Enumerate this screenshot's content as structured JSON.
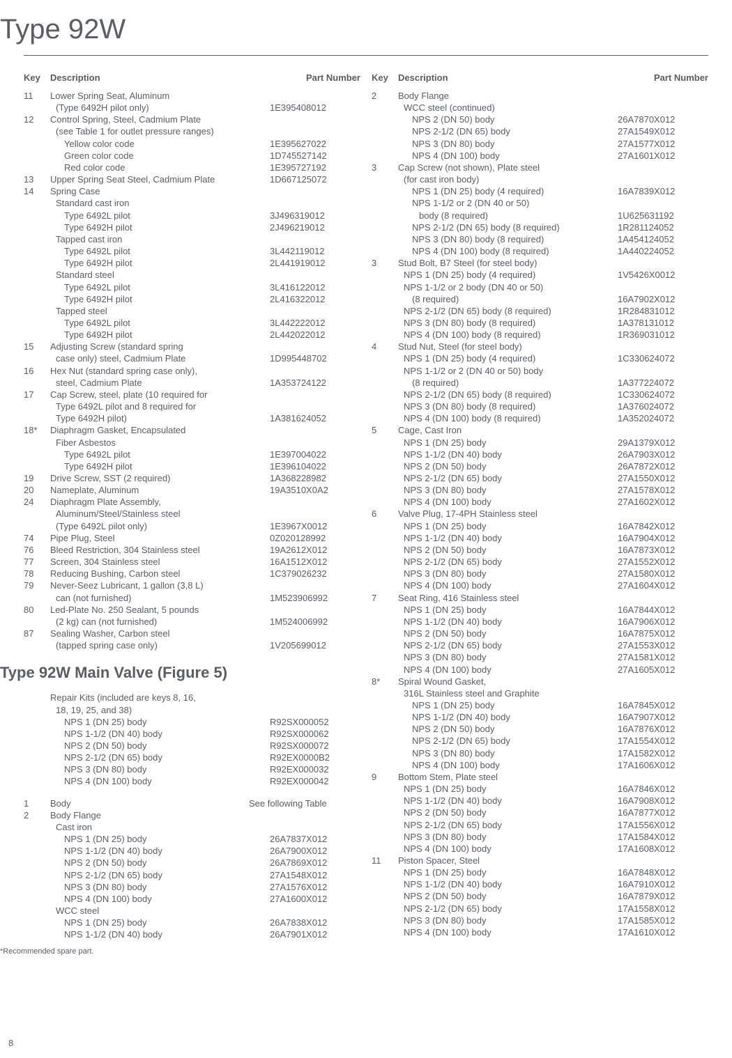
{
  "page_number": "8",
  "title": "Type 92W",
  "section_title": "Type 92W Main Valve (Figure 5)",
  "footnote": "*Recommended spare part.",
  "headers": {
    "key": "Key",
    "description": "Description",
    "part": "Part Number"
  },
  "left": [
    {
      "k": "11",
      "d": "Lower Spring Seat, Aluminum"
    },
    {
      "d": "(Type 6492H pilot only)",
      "i": 1,
      "p": "1E395408012"
    },
    {
      "k": "12",
      "d": "Control Spring, Steel, Cadmium Plate"
    },
    {
      "d": "(see Table 1 for outlet pressure ranges)",
      "i": 1
    },
    {
      "d": "Yellow color code",
      "i": 2,
      "p": "1E395627022"
    },
    {
      "d": "Green color code",
      "i": 2,
      "p": "1D745527142"
    },
    {
      "d": "Red color code",
      "i": 2,
      "p": "1E395727192"
    },
    {
      "k": "13",
      "d": "Upper Spring Seat Steel, Cadmium Plate",
      "p": "1D667125072"
    },
    {
      "k": "14",
      "d": "Spring Case"
    },
    {
      "d": "Standard cast iron",
      "i": 1
    },
    {
      "d": "Type 6492L pilot",
      "i": 2,
      "p": "3J496319012"
    },
    {
      "d": "Type 6492H pilot",
      "i": 2,
      "p": "2J496219012"
    },
    {
      "d": "Tapped cast iron",
      "i": 1
    },
    {
      "d": "Type 6492L pilot",
      "i": 2,
      "p": "3L442119012"
    },
    {
      "d": "Type 6492H pilot",
      "i": 2,
      "p": "2L441919012"
    },
    {
      "d": "Standard steel",
      "i": 1
    },
    {
      "d": "Type 6492L pilot",
      "i": 2,
      "p": "3L416122012"
    },
    {
      "d": "Type 6492H pilot",
      "i": 2,
      "p": "2L416322012"
    },
    {
      "d": "Tapped steel",
      "i": 1
    },
    {
      "d": "Type 6492L pilot",
      "i": 2,
      "p": "3L442222012"
    },
    {
      "d": "Type 6492H pilot",
      "i": 2,
      "p": "2L442022012"
    },
    {
      "k": "15",
      "d": "Adjusting Screw (standard spring"
    },
    {
      "d": "case only) steel, Cadmium Plate",
      "i": 1,
      "p": "1D995448702"
    },
    {
      "k": "16",
      "d": "Hex Nut (standard spring case only),"
    },
    {
      "d": "steel, Cadmium Plate",
      "i": 1,
      "p": "1A353724122"
    },
    {
      "k": "17",
      "d": "Cap Screw, steel, plate (10 required for"
    },
    {
      "d": "Type 6492L pilot and 8 required for",
      "i": 1
    },
    {
      "d": "Type 6492H pilot)",
      "i": 1,
      "p": "1A381624052"
    },
    {
      "k": "18*",
      "d": "Diaphragm Gasket, Encapsulated"
    },
    {
      "d": "Fiber Asbestos",
      "i": 1
    },
    {
      "d": "Type 6492L pilot",
      "i": 2,
      "p": "1E397004022"
    },
    {
      "d": "Type 6492H pilot",
      "i": 2,
      "p": "1E396104022"
    },
    {
      "k": "19",
      "d": "Drive Screw, SST (2 required)",
      "p": "1A368228982"
    },
    {
      "k": "20",
      "d": "Nameplate, Aluminum",
      "p": "19A3510X0A2"
    },
    {
      "k": "24",
      "d": "Diaphragm Plate Assembly,"
    },
    {
      "d": "Aluminum/Steel/Stainless steel",
      "i": 1
    },
    {
      "d": "(Type 6492L pilot only)",
      "i": 1,
      "p": "1E3967X0012"
    },
    {
      "k": "74",
      "d": "Pipe Plug, Steel",
      "p": "0Z020128992"
    },
    {
      "k": "76",
      "d": "Bleed Restriction, 304 Stainless steel",
      "p": "19A2612X012"
    },
    {
      "k": "77",
      "d": "Screen, 304 Stainless steel",
      "p": "16A1512X012"
    },
    {
      "k": "78",
      "d": "Reducing Bushing, Carbon steel",
      "p": "1C379026232"
    },
    {
      "k": "79",
      "d": "Never-Seez Lubricant, 1 gallon (3,8 L)"
    },
    {
      "d": "can (not furnished)",
      "i": 1,
      "p": "1M523906992"
    },
    {
      "k": "80",
      "d": "Led-Plate No. 250 Sealant, 5 pounds"
    },
    {
      "d": "(2 kg) can (not furnished)",
      "i": 1,
      "p": "1M524006992"
    },
    {
      "k": "87",
      "d": "Sealing Washer, Carbon steel"
    },
    {
      "d": "(tapped spring case only)",
      "i": 1,
      "p": "1V205699012"
    }
  ],
  "left2": [
    {
      "d": "Repair Kits  (included  are  keys  8, 16,"
    },
    {
      "d": "18, 19,  25, and 38)",
      "i": 1
    },
    {
      "d": "NPS 1 (DN 25)  body",
      "i": 2,
      "p": "R92SX000052"
    },
    {
      "d": "NPS 1-1/2 (DN 40)  body",
      "i": 2,
      "p": "R92SX000062"
    },
    {
      "d": "NPS 2 (DN 50)  body",
      "i": 2,
      "p": "R92SX000072"
    },
    {
      "d": "NPS 2-1/2 (DN 65)  body",
      "i": 2,
      "p": "R92EX0000B2"
    },
    {
      "d": "NPS 3 (DN 80)  body",
      "i": 2,
      "p": "R92EX000032"
    },
    {
      "d": "NPS 4 (DN 100)  body",
      "i": 2,
      "p": "R92EX000042"
    },
    {
      "sp": true
    },
    {
      "k": "1",
      "d": "Body",
      "p": "See following Table",
      "wide": true
    },
    {
      "k": "2",
      "d": "Body Flange"
    },
    {
      "d": "Cast iron",
      "i": 1
    },
    {
      "d": "NPS 1 (DN 25) body",
      "i": 2,
      "p": "26A7837X012"
    },
    {
      "d": "NPS 1-1/2 (DN 40) body",
      "i": 2,
      "p": "26A7900X012"
    },
    {
      "d": "NPS 2 (DN 50) body",
      "i": 2,
      "p": "26A7869X012"
    },
    {
      "d": "NPS 2-1/2 (DN 65) body",
      "i": 2,
      "p": "27A1548X012"
    },
    {
      "d": "NPS 3 (DN 80) body",
      "i": 2,
      "p": "27A1576X012"
    },
    {
      "d": "NPS 4 (DN 100) body",
      "i": 2,
      "p": "27A1600X012"
    },
    {
      "d": "WCC steel",
      "i": 1
    },
    {
      "d": "NPS 1 (DN 25) body",
      "i": 2,
      "p": "26A7838X012"
    },
    {
      "d": "NPS 1-1/2 (DN 40) body",
      "i": 2,
      "p": "26A7901X012"
    }
  ],
  "right": [
    {
      "k": "2",
      "d": "Body Flange"
    },
    {
      "d": "WCC steel (continued)",
      "i": 1
    },
    {
      "d": "NPS 2 (DN 50) body",
      "i": 2,
      "p": "26A7870X012"
    },
    {
      "d": "NPS 2-1/2 (DN 65) body",
      "i": 2,
      "p": "27A1549X012"
    },
    {
      "d": "NPS 3 (DN 80) body",
      "i": 2,
      "p": "27A1577X012"
    },
    {
      "d": "NPS 4 (DN 100) body",
      "i": 2,
      "p": "27A1601X012"
    },
    {
      "k": "3",
      "d": "Cap Screw (not shown), Plate steel"
    },
    {
      "d": "(for cast iron body)",
      "i": 1
    },
    {
      "d": "NPS 1 (DN 25) body (4 required)",
      "i": 2,
      "p": "16A7839X012"
    },
    {
      "d": "NPS 1-1/2 or 2 (DN 40 or 50)",
      "i": 2
    },
    {
      "d": "body (8 required)",
      "i": 3,
      "p": "1U625631192"
    },
    {
      "d": "NPS 2-1/2 (DN 65) body (8 required)",
      "i": 2,
      "p": "1R281124052"
    },
    {
      "d": "NPS 3 (DN 80) body (8 required)",
      "i": 2,
      "p": "1A454124052"
    },
    {
      "d": "NPS 4 (DN 100) body (8 required)",
      "i": 2,
      "p": "1A440224052"
    },
    {
      "k": "3",
      "d": "Stud Bolt, B7 Steel (for steel body)"
    },
    {
      "d": "NPS 1 (DN 25) body (4 required)",
      "i": 1,
      "p": "1V5426X0012"
    },
    {
      "d": "NPS 1-1/2 or 2 body (DN 40 or 50)",
      "i": 1
    },
    {
      "d": "(8 required)",
      "i": 2,
      "p": "16A7902X012"
    },
    {
      "d": "NPS 2-1/2 (DN 65) body (8 required)",
      "i": 1,
      "p": "1R284831012"
    },
    {
      "d": "NPS 3 (DN 80) body (8 required)",
      "i": 1,
      "p": "1A378131012"
    },
    {
      "d": "NPS 4 (DN 100) body (8 required)",
      "i": 1,
      "p": "1R369031012"
    },
    {
      "k": "4",
      "d": "Stud Nut, Steel (for steel body)"
    },
    {
      "d": "NPS 1 (DN 25) body (4 required)",
      "i": 1,
      "p": "1C330624072"
    },
    {
      "d": "NPS 1-1/2 or 2 (DN 40 or 50) body",
      "i": 1
    },
    {
      "d": "(8 required)",
      "i": 2,
      "p": "1A377224072"
    },
    {
      "d": "NPS 2-1/2 (DN 65) body (8 required)",
      "i": 1,
      "p": "1C330624072"
    },
    {
      "d": "NPS 3 (DN 80) body (8 required)",
      "i": 1,
      "p": "1A376024072"
    },
    {
      "d": "NPS 4 (DN 100) body (8 required)",
      "i": 1,
      "p": "1A352024072"
    },
    {
      "k": "5",
      "d": "Cage, Cast Iron"
    },
    {
      "d": "NPS 1 (DN 25) body",
      "i": 1,
      "p": "29A1379X012"
    },
    {
      "d": "NPS 1-1/2 (DN 40) body",
      "i": 1,
      "p": "26A7903X012"
    },
    {
      "d": "NPS 2 (DN 50) body",
      "i": 1,
      "p": "26A7872X012"
    },
    {
      "d": "NPS 2-1/2 (DN 65) body",
      "i": 1,
      "p": "27A1550X012"
    },
    {
      "d": "NPS 3 (DN 80) body",
      "i": 1,
      "p": "27A1578X012"
    },
    {
      "d": "NPS 4 (DN 100) body",
      "i": 1,
      "p": "27A1602X012"
    },
    {
      "k": "6",
      "d": "Valve Plug, 17-4PH Stainless steel"
    },
    {
      "d": "NPS 1 (DN 25) body",
      "i": 1,
      "p": "16A7842X012"
    },
    {
      "d": "NPS 1-1/2 (DN 40) body",
      "i": 1,
      "p": "16A7904X012"
    },
    {
      "d": "NPS 2 (DN 50) body",
      "i": 1,
      "p": "16A7873X012"
    },
    {
      "d": "NPS 2-1/2 (DN 65) body",
      "i": 1,
      "p": "27A1552X012"
    },
    {
      "d": "NPS 3 (DN 80) body",
      "i": 1,
      "p": "27A1580X012"
    },
    {
      "d": "NPS 4 (DN 100) body",
      "i": 1,
      "p": "27A1604X012"
    },
    {
      "k": "7",
      "d": "Seat Ring, 416 Stainless steel"
    },
    {
      "d": "NPS 1 (DN 25) body",
      "i": 1,
      "p": "16A7844X012"
    },
    {
      "d": "NPS 1-1/2 (DN 40) body",
      "i": 1,
      "p": "16A7906X012"
    },
    {
      "d": "NPS 2 (DN 50) body",
      "i": 1,
      "p": "16A7875X012"
    },
    {
      "d": "NPS 2-1/2 (DN 65) body",
      "i": 1,
      "p": "27A1553X012"
    },
    {
      "d": "NPS 3 (DN 80) body",
      "i": 1,
      "p": "27A1581X012"
    },
    {
      "d": "NPS 4 (DN 100) body",
      "i": 1,
      "p": "27A1605X012"
    },
    {
      "k": "8*",
      "d": "Spiral Wound Gasket,"
    },
    {
      "d": "316L Stainless steel and Graphite",
      "i": 1
    },
    {
      "d": "NPS 1 (DN 25) body",
      "i": 2,
      "p": "16A7845X012"
    },
    {
      "d": "NPS 1-1/2 (DN 40) body",
      "i": 2,
      "p": "16A7907X012"
    },
    {
      "d": "NPS 2 (DN 50) body",
      "i": 2,
      "p": "16A7876X012"
    },
    {
      "d": "NPS 2-1/2 (DN 65) body",
      "i": 2,
      "p": "17A1554X012"
    },
    {
      "d": "NPS 3 (DN 80) body",
      "i": 2,
      "p": "17A1582X012"
    },
    {
      "d": "NPS 4 (DN 100) body",
      "i": 2,
      "p": "17A1606X012"
    },
    {
      "k": "9",
      "d": "Bottom Stem, Plate steel"
    },
    {
      "d": "NPS 1 (DN 25) body",
      "i": 1,
      "p": "16A7846X012"
    },
    {
      "d": "NPS 1-1/2 (DN 40) body",
      "i": 1,
      "p": "16A7908X012"
    },
    {
      "d": "NPS 2 (DN 50) body",
      "i": 1,
      "p": "16A7877X012"
    },
    {
      "d": "NPS 2-1/2 (DN 65) body",
      "i": 1,
      "p": "17A1556X012"
    },
    {
      "d": "NPS 3 (DN 80) body",
      "i": 1,
      "p": "17A1584X012"
    },
    {
      "d": "NPS 4 (DN 100) body",
      "i": 1,
      "p": "17A1608X012"
    },
    {
      "k": "11",
      "d": "Piston Spacer, Steel"
    },
    {
      "d": "NPS 1 (DN 25) body",
      "i": 1,
      "p": "16A7848X012"
    },
    {
      "d": "NPS 1-1/2 (DN 40) body",
      "i": 1,
      "p": "16A7910X012"
    },
    {
      "d": "NPS 2 (DN 50) body",
      "i": 1,
      "p": "16A7879X012"
    },
    {
      "d": "NPS 2-1/2 (DN 65) body",
      "i": 1,
      "p": "17A1558X012"
    },
    {
      "d": "NPS 3 (DN 80) body",
      "i": 1,
      "p": "17A1585X012"
    },
    {
      "d": "NPS 4 (DN 100) body",
      "i": 1,
      "p": "17A1610X012"
    }
  ]
}
